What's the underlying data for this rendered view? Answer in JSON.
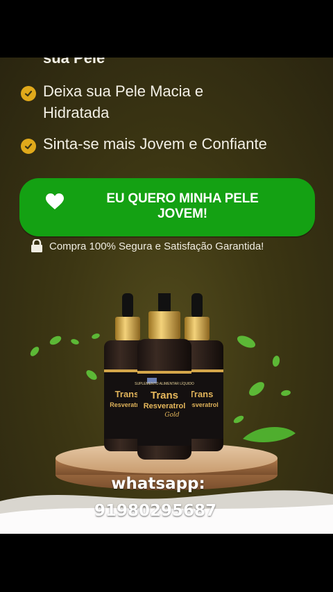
{
  "top_partial_text": "sua Pele",
  "benefits": [
    {
      "label": "Deixa sua Pele Macia e Hidratada",
      "line1": "Deixa sua Pele Macia e",
      "line2": "Hidratada"
    },
    {
      "label": "Sinta-se mais Jovem e Confiante"
    }
  ],
  "cta": {
    "line1": "EU QUERO MINHA PELE",
    "line2": "JOVEM!",
    "icon": "heart-icon"
  },
  "secure_text": "Compra 100% Segura e Satisfação Garantida!",
  "product": {
    "brand_line1": "Trans",
    "brand_line2": "Resveratrol",
    "brand_line3": "Gold",
    "subtitle": "SUPLEMENTO ALIMENTAR LÍQUIDO"
  },
  "whatsapp": {
    "label": "whatsapp:",
    "number": "91980295687"
  },
  "colors": {
    "accent_green": "#14a113",
    "check_gold": "#e0a91b",
    "bg_olive": "#3c3613"
  }
}
